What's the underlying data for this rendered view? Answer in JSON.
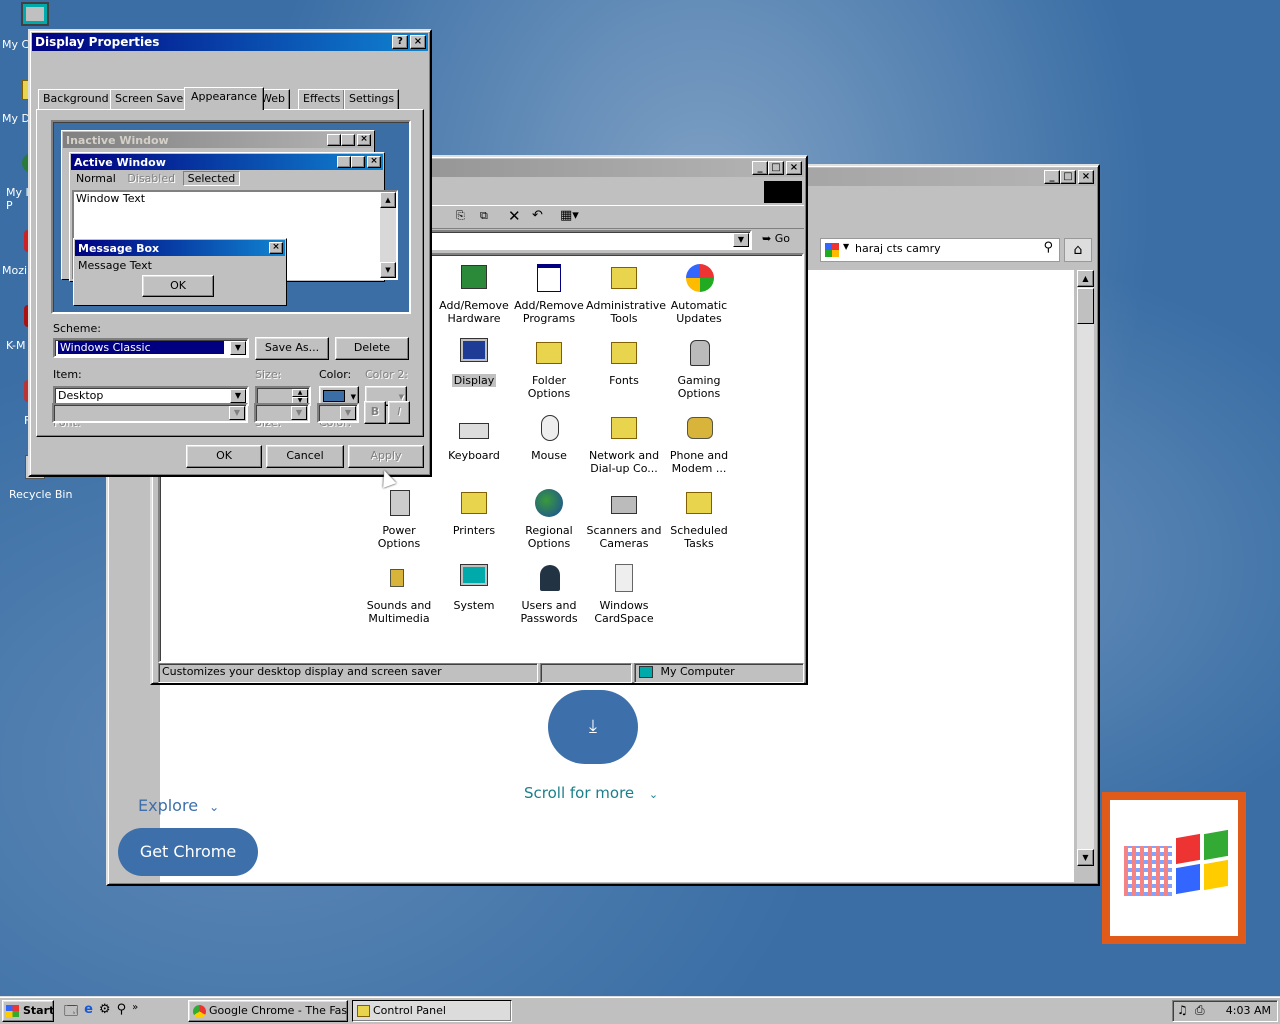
{
  "desktop": {
    "icons": [
      "My C",
      "My D",
      "My I P",
      "Mozil",
      "K-M",
      "F",
      "Recycle Bin"
    ]
  },
  "display_props": {
    "title": "Display Properties",
    "tabs": [
      "Background",
      "Screen Saver",
      "Appearance",
      "Web",
      "Effects",
      "Settings"
    ],
    "preview": {
      "inactive_title": "Inactive Window",
      "active_title": "Active Window",
      "menu": [
        "Normal",
        "Disabled",
        "Selected"
      ],
      "window_text": "Window Text",
      "msgbox_title": "Message Box",
      "msgbox_text": "Message Text",
      "msgbox_ok": "OK"
    },
    "scheme_label": "Scheme:",
    "scheme_value": "Windows Classic",
    "save_as": "Save As...",
    "delete": "Delete",
    "item_label": "Item:",
    "item_value": "Desktop",
    "size_label": "Size:",
    "color_label": "Color:",
    "color2_label": "Color 2:",
    "font_label": "Font:",
    "font_size_label": "Size:",
    "font_color_label": "Color:",
    "bold": "B",
    "italic": "I",
    "ok": "OK",
    "cancel": "Cancel",
    "apply": "Apply",
    "colors": {
      "desktop_color": "#3a6ea5"
    }
  },
  "control_panel": {
    "go": "Go",
    "items": [
      {
        "label": "Add/Remove Hardware",
        "icon": "hardware-icon"
      },
      {
        "label": "Add/Remove Programs",
        "icon": "programs-icon"
      },
      {
        "label": "Administrative Tools",
        "icon": "admin-tools-icon"
      },
      {
        "label": "Automatic Updates",
        "icon": "updates-icon"
      },
      {
        "label": "Display",
        "icon": "display-icon"
      },
      {
        "label": "Folder Options",
        "icon": "folder-options-icon"
      },
      {
        "label": "Fonts",
        "icon": "fonts-icon"
      },
      {
        "label": "Gaming Options",
        "icon": "gaming-icon"
      },
      {
        "label": "Keyboard",
        "icon": "keyboard-icon"
      },
      {
        "label": "Mouse",
        "icon": "mouse-icon"
      },
      {
        "label": "Network and Dial-up Co...",
        "icon": "network-icon"
      },
      {
        "label": "Phone and Modem ...",
        "icon": "phone-icon"
      },
      {
        "label": "Power Options",
        "icon": "power-icon"
      },
      {
        "label": "Printers",
        "icon": "printers-icon"
      },
      {
        "label": "Regional Options",
        "icon": "globe-icon"
      },
      {
        "label": "Scanners and Cameras",
        "icon": "scanner-icon"
      },
      {
        "label": "Scheduled Tasks",
        "icon": "tasks-icon"
      },
      {
        "label": "Sounds and Multimedia",
        "icon": "sound-icon"
      },
      {
        "label": "System",
        "icon": "system-icon"
      },
      {
        "label": "Users and Passwords",
        "icon": "users-icon"
      },
      {
        "label": "Windows CardSpace",
        "icon": "cardspace-icon"
      }
    ],
    "status_text": "Customizes your desktop display and screen saver",
    "status_zone": "My Computer"
  },
  "chrome": {
    "search_text": "haraj cts camry",
    "scroll_more": "Scroll for more",
    "explore": "Explore",
    "get_chrome": "Get Chrome"
  },
  "taskbar": {
    "start": "Start",
    "task1": "Google Chrome - The Fast ...",
    "task2": "Control Panel",
    "clock": "4:03 AM"
  }
}
